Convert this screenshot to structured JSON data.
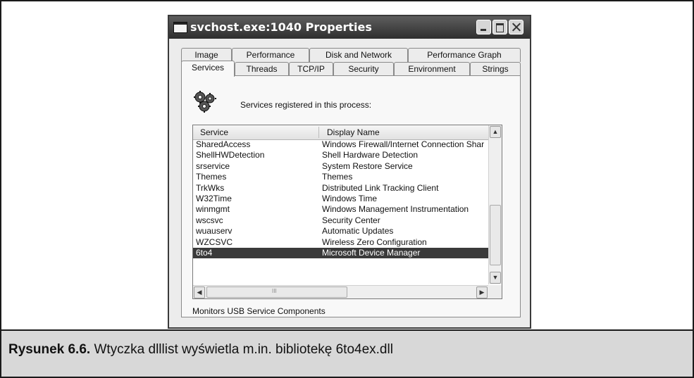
{
  "window": {
    "title": "svchost.exe:1040 Properties"
  },
  "tabs_row1": [
    "Image",
    "Performance",
    "Disk and Network",
    "Performance Graph"
  ],
  "tabs_row2": [
    "Services",
    "Threads",
    "TCP/IP",
    "Security",
    "Environment",
    "Strings"
  ],
  "active_tab": "Services",
  "services_label": "Services registered in this process:",
  "list": {
    "headers": [
      "Service",
      "Display Name"
    ],
    "rows": [
      {
        "service": "SharedAccess",
        "display": "Windows Firewall/Internet Connection Shar"
      },
      {
        "service": "ShellHWDetection",
        "display": "Shell Hardware Detection"
      },
      {
        "service": "srservice",
        "display": "System Restore Service"
      },
      {
        "service": "Themes",
        "display": "Themes"
      },
      {
        "service": "TrkWks",
        "display": "Distributed Link Tracking Client"
      },
      {
        "service": "W32Time",
        "display": "Windows Time"
      },
      {
        "service": "winmgmt",
        "display": "Windows Management Instrumentation"
      },
      {
        "service": "wscsvc",
        "display": "Security Center"
      },
      {
        "service": "wuauserv",
        "display": "Automatic Updates"
      },
      {
        "service": "WZCSVC",
        "display": "Wireless Zero Configuration"
      },
      {
        "service": "6to4",
        "display": "Microsoft Device Manager",
        "selected": true
      }
    ],
    "hscroll_label": "III"
  },
  "description": "Monitors USB Service Components",
  "caption": {
    "figure_number": "Rysunek 6.6.",
    "text": "Wtyczka dlllist wyświetla m.in. bibliotekę 6to4ex.dll"
  },
  "icons": {
    "window_icon": "window-icon",
    "services_icon": "gear-icon",
    "scroll_up": "scroll-up-icon",
    "scroll_down": "scroll-down-icon",
    "scroll_left": "scroll-left-icon",
    "scroll_right": "scroll-right-icon"
  }
}
